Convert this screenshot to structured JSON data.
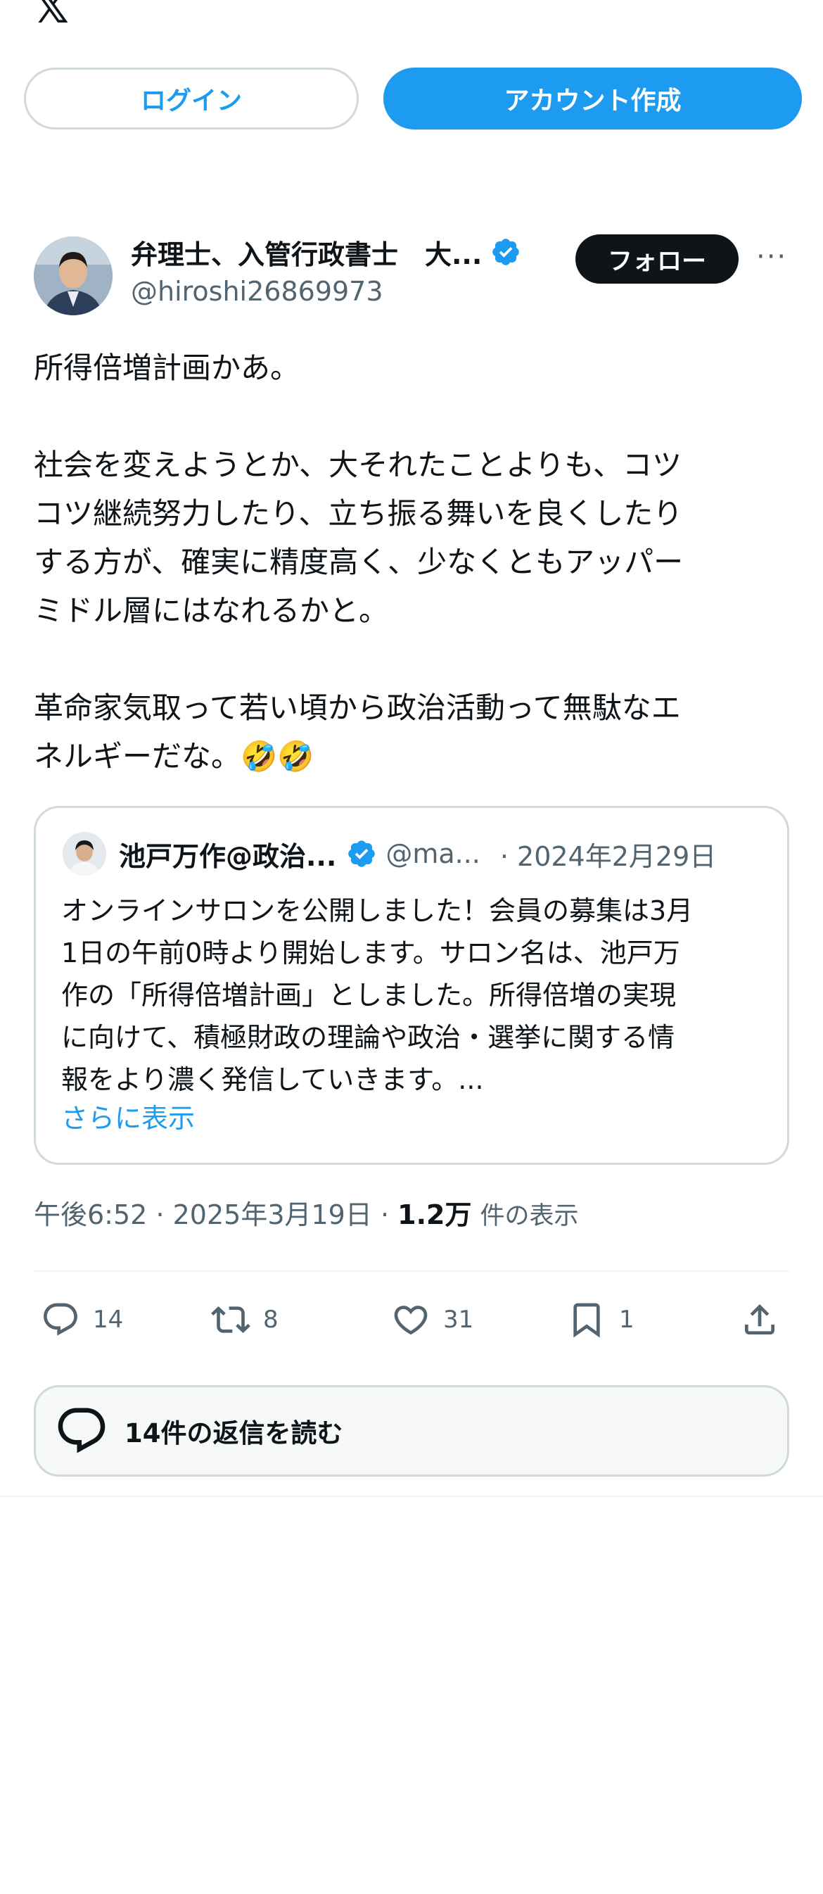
{
  "header": {
    "logo": "𝕏",
    "login_label": "ログイン",
    "signup_label": "アカウント作成"
  },
  "tweet": {
    "author_name": "弁理士、入管行政書士　大...",
    "handle": "@hiroshi26869973",
    "follow_label": "フォロー",
    "more_label": "···",
    "text": [
      "所得倍増計画かあ。",
      "社会を変えようとか、大それたことよりも、コツ\nコツ継続努力したり、立ち振る舞いを良くしたり\nする方が、確実に精度高く、少なくともアッパー\nミドル層にはなれるかと。",
      "革命家気取って若い頃から政治活動って無駄なエ\nネルギーだな。🤣🤣"
    ]
  },
  "quote": {
    "author_name": "池戸万作@政治...",
    "handle": "@ma...",
    "date": "· 2024年2月29日",
    "text": "オンラインサロンを公開しました！会員の募集は3月\n1日の午前0時より開始します。サロン名は、池戸万\n作の「所得倍増計画」としました。所得倍増の実現\nに向けて、積極財政の理論や政治・選挙に関する情\n報をより濃く発信していきます。...",
    "show_more": "さらに表示"
  },
  "meta": {
    "time": "午後6:52",
    "date": "2025年3月19日",
    "views_count": "1.2万",
    "views_label": "件の表示"
  },
  "actions": {
    "reply_count": "14",
    "retweet_count": "8",
    "like_count": "31",
    "bookmark_count": "1"
  },
  "replies": {
    "label": "14件の返信を読む"
  },
  "colors": {
    "accent": "#1d9bf0",
    "text": "#0f1419",
    "muted": "#536471",
    "border": "#cfd9de"
  },
  "icons": [
    "x-logo",
    "verified-badge-icon",
    "reply-icon",
    "retweet-icon",
    "like-icon",
    "bookmark-icon",
    "share-icon",
    "reply-bubble-icon"
  ]
}
